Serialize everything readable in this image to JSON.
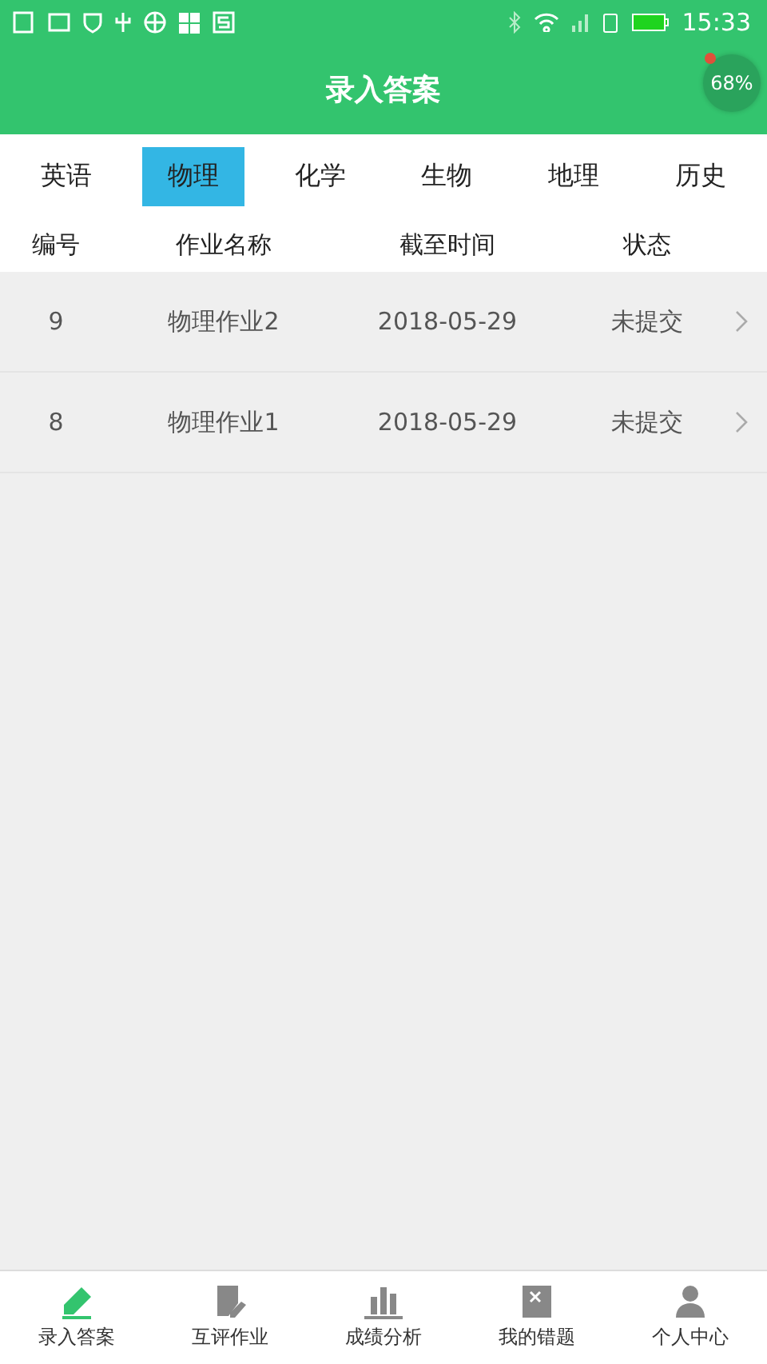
{
  "status_bar": {
    "time": "15:33"
  },
  "header": {
    "title": "录入答案",
    "badge": "68%"
  },
  "tabs": [
    {
      "label": "英语",
      "selected": false
    },
    {
      "label": "物理",
      "selected": true
    },
    {
      "label": "化学",
      "selected": false
    },
    {
      "label": "生物",
      "selected": false
    },
    {
      "label": "地理",
      "selected": false
    },
    {
      "label": "历史",
      "selected": false
    }
  ],
  "table": {
    "columns": [
      "编号",
      "作业名称",
      "截至时间",
      "状态"
    ],
    "rows": [
      [
        "9",
        "物理作业2",
        "2018-05-29",
        "未提交"
      ],
      [
        "8",
        "物理作业1",
        "2018-05-29",
        "未提交"
      ]
    ]
  },
  "bottom_nav": [
    {
      "label": "录入答案",
      "kind": "pencil",
      "selected": true
    },
    {
      "label": "互评作业",
      "kind": "note",
      "selected": false
    },
    {
      "label": "成绩分析",
      "kind": "chart",
      "selected": false
    },
    {
      "label": "我的错题",
      "kind": "wrong",
      "selected": false
    },
    {
      "label": "个人中心",
      "kind": "person",
      "selected": false
    }
  ]
}
